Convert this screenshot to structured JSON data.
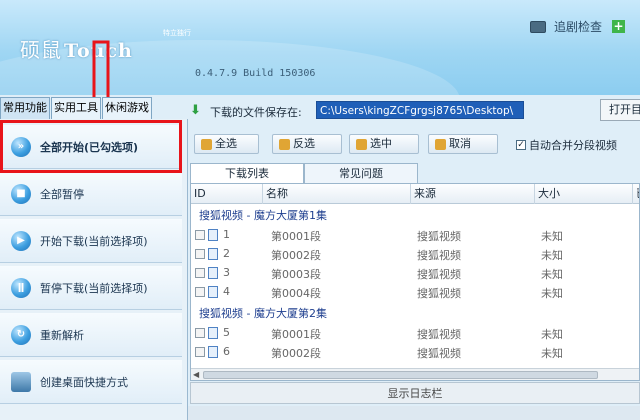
{
  "header": {
    "logo_cn": "硕鼠",
    "logo_en": "Touch",
    "logo_sub": "特立独行",
    "version": "0.4.7.9  Build 150306",
    "track_update_label": "追剧检查",
    "plus_icon": "+"
  },
  "tabs": [
    {
      "label": "常用功能",
      "active": true
    },
    {
      "label": "实用工具",
      "active": false
    },
    {
      "label": "休闲游戏",
      "active": false
    }
  ],
  "sidebar": {
    "items": [
      {
        "label": "全部开始(已勾选项)",
        "icon": "play-all-icon",
        "glyph": "»"
      },
      {
        "label": "全部暂停",
        "icon": "stop-icon",
        "glyph": "■"
      },
      {
        "label": "开始下载(当前选择项)",
        "icon": "play-icon",
        "glyph": "▶"
      },
      {
        "label": "暂停下载(当前选择项)",
        "icon": "pause-icon",
        "glyph": "ǁ"
      },
      {
        "label": "重新解析",
        "icon": "refresh-icon",
        "glyph": "↻"
      },
      {
        "label": "创建桌面快捷方式",
        "icon": "desktop-shortcut-icon",
        "glyph": ""
      }
    ]
  },
  "path": {
    "label": "下载的文件保存在:",
    "value": "C:\\Users\\kingZCFgrgsj8765\\Desktop\\",
    "open_label": "打开目"
  },
  "toolbar": {
    "select_all": "全选",
    "invert": "反选",
    "select_checked": "选中",
    "cancel": "取消",
    "auto_merge": "自动合并分段视频",
    "auto_merge_checked": true
  },
  "list_tabs": [
    {
      "label": "下载列表",
      "active": true
    },
    {
      "label": "常见问题",
      "active": false
    }
  ],
  "table": {
    "columns": [
      "ID",
      "名称",
      "来源",
      "大小",
      "已"
    ],
    "groups": [
      {
        "title": "搜狐视频 - 魔方大厦第1集",
        "rows": [
          {
            "id": "1",
            "name": "第0001段",
            "source": "搜狐视频",
            "size": "未知"
          },
          {
            "id": "2",
            "name": "第0002段",
            "source": "搜狐视频",
            "size": "未知"
          },
          {
            "id": "3",
            "name": "第0003段",
            "source": "搜狐视频",
            "size": "未知"
          },
          {
            "id": "4",
            "name": "第0004段",
            "source": "搜狐视频",
            "size": "未知"
          }
        ]
      },
      {
        "title": "搜狐视频 - 魔方大厦第2集",
        "rows": [
          {
            "id": "5",
            "name": "第0001段",
            "source": "搜狐视频",
            "size": "未知"
          },
          {
            "id": "6",
            "name": "第0002段",
            "source": "搜狐视频",
            "size": "未知"
          }
        ]
      }
    ]
  },
  "log_label": "显示日志栏"
}
